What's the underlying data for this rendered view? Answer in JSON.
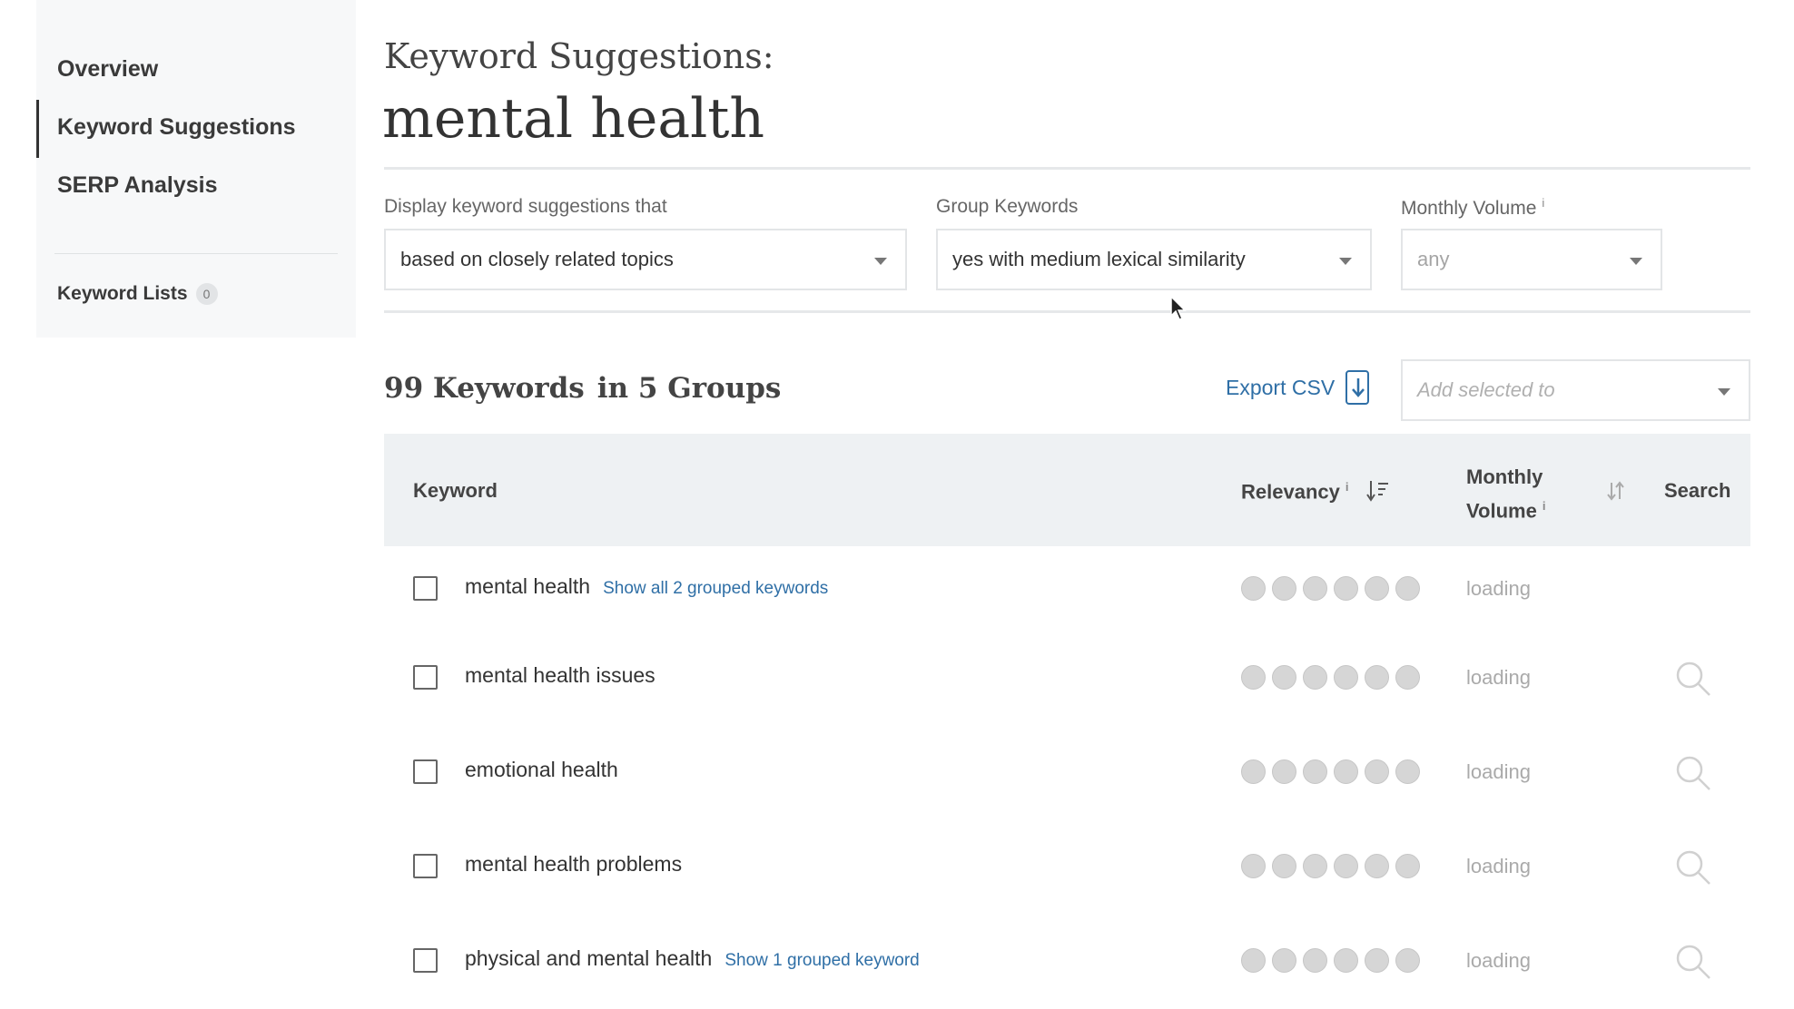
{
  "sidebar": {
    "items": [
      {
        "label": "Overview",
        "active": false
      },
      {
        "label": "Keyword Suggestions",
        "active": true
      },
      {
        "label": "SERP Analysis",
        "active": false
      }
    ],
    "keyword_lists": {
      "label": "Keyword Lists",
      "count": "0"
    }
  },
  "header": {
    "subtitle": "Keyword Suggestions:",
    "title": "mental health"
  },
  "filters": {
    "display": {
      "label": "Display keyword suggestions that",
      "value": "based on closely related topics"
    },
    "group": {
      "label": "Group Keywords",
      "value": "yes with medium lexical similarity"
    },
    "volume": {
      "label": "Monthly Volume",
      "info": "i",
      "value": "any"
    }
  },
  "results": {
    "keywords_count": "99 Keywords",
    "groups_count": "in 5 Groups",
    "export_label": "Export CSV",
    "add_selected_placeholder": "Add selected to"
  },
  "table": {
    "headers": {
      "keyword": "Keyword",
      "relevancy": "Relevancy",
      "relevancy_info": "i",
      "volume_line1": "Monthly",
      "volume_line2": "Volume",
      "volume_info": "i",
      "search": "Search"
    },
    "rows": [
      {
        "keyword": "mental health",
        "group_link": "Show all 2 grouped keywords",
        "volume": "loading",
        "has_search": false
      },
      {
        "keyword": "mental health issues",
        "group_link": "",
        "volume": "loading",
        "has_search": true
      },
      {
        "keyword": "emotional health",
        "group_link": "",
        "volume": "loading",
        "has_search": true
      },
      {
        "keyword": "mental health problems",
        "group_link": "",
        "volume": "loading",
        "has_search": true
      },
      {
        "keyword": "physical and mental health",
        "group_link": "Show 1 grouped keyword",
        "volume": "loading",
        "has_search": true
      }
    ]
  },
  "colors": {
    "link": "#2f6fa6",
    "sidebar_bg": "#f7f8f9",
    "table_header_bg": "#eef1f3",
    "relevancy_dot": "#d6d6d6"
  }
}
